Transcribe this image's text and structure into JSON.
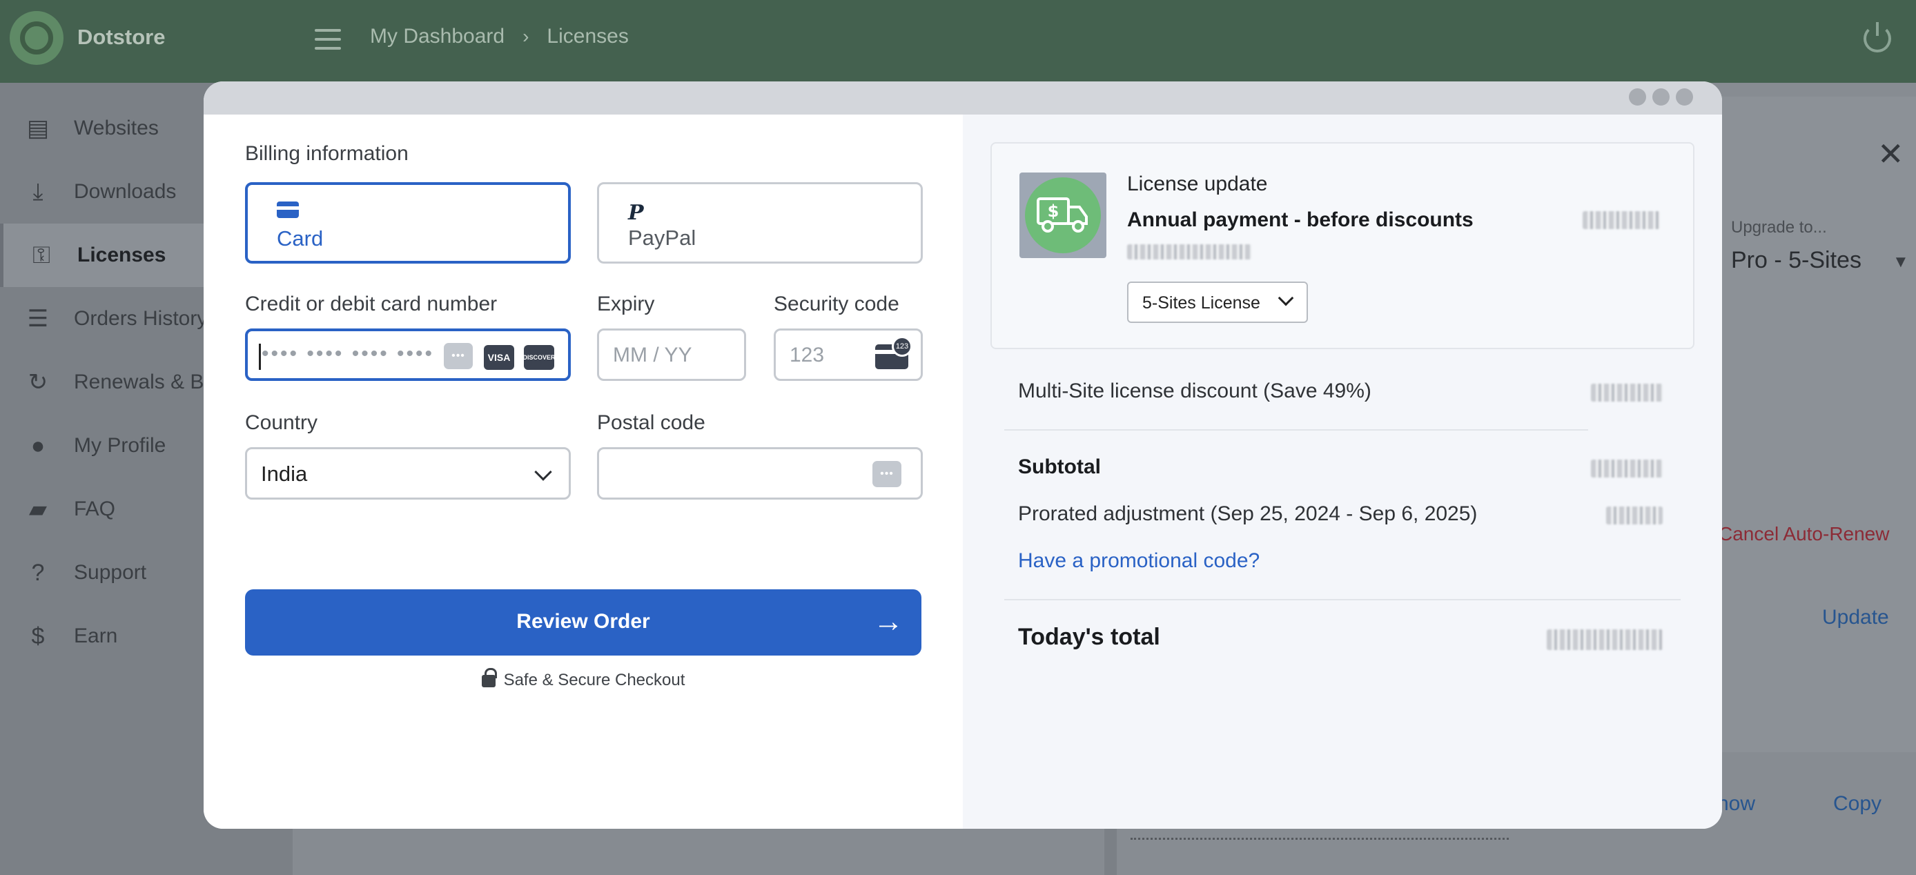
{
  "app": {
    "brand": "Dotstore",
    "breadcrumb": [
      "My Dashboard",
      "Licenses"
    ]
  },
  "sidebar": {
    "items": [
      {
        "label": "Websites",
        "icon": "browser-window-icon"
      },
      {
        "label": "Downloads",
        "icon": "download-icon"
      },
      {
        "label": "Licenses",
        "icon": "key-icon",
        "active": true
      },
      {
        "label": "Orders History",
        "icon": "receipt-icon"
      },
      {
        "label": "Renewals & Bil",
        "icon": "refresh-icon"
      },
      {
        "label": "My Profile",
        "icon": "person-icon"
      },
      {
        "label": "FAQ",
        "icon": "chat-icon"
      },
      {
        "label": "Support",
        "icon": "help-icon"
      },
      {
        "label": "Earn",
        "icon": "dollar-icon"
      }
    ]
  },
  "background_panel": {
    "upgrade_label": "Upgrade to...",
    "upgrade_value": "Pro - 5-Sites",
    "cancel_auto_renew": "Cancel Auto-Renew",
    "update": "Update",
    "show": "how",
    "copy": "Copy"
  },
  "billing": {
    "title": "Billing information",
    "methods": [
      {
        "label": "Card",
        "icon": "card-icon",
        "selected": true
      },
      {
        "label": "PayPal",
        "icon": "paypal-icon",
        "selected": false
      }
    ],
    "card_number_label": "Credit or debit card number",
    "card_number_value": "•••• •••• •••• ••••",
    "card_brands": [
      "VISA",
      "DISCOVER"
    ],
    "expiry_label": "Expiry",
    "expiry_placeholder": "MM / YY",
    "security_label": "Security code",
    "security_placeholder": "123",
    "country_label": "Country",
    "country_value": "India",
    "postal_label": "Postal code",
    "postal_value": "",
    "review_button": "Review Order",
    "secure_text": "Safe & Secure Checkout"
  },
  "summary": {
    "license_update": "License update",
    "annual_payment": "Annual payment - before discounts",
    "license_select": "5-Sites License",
    "multisite_discount": "Multi-Site license discount (Save 49%)",
    "subtotal": "Subtotal",
    "prorated": "Prorated adjustment (Sep 25, 2024 - Sep 6, 2025)",
    "promo_link": "Have a promotional code?",
    "todays_total": "Today's total"
  },
  "colors": {
    "accent": "#2a62c5",
    "topbar": "#44614f",
    "danger": "#8c2b36"
  }
}
